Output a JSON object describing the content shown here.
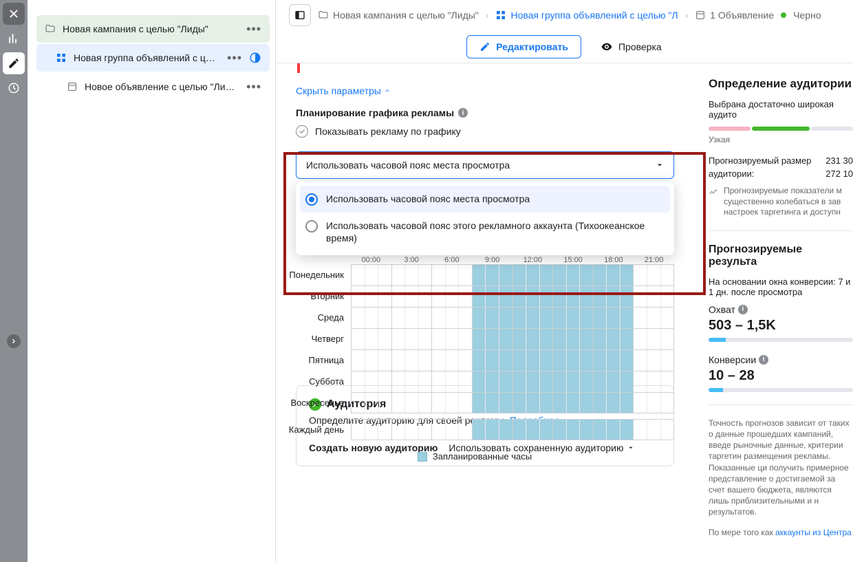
{
  "rail": {
    "close": "×"
  },
  "tree": {
    "campaign": "Новая кампания с целью \"Лиды\"",
    "adset": "Новая группа объявлений с це…",
    "ad": "Новое объявление с целью \"Лиды\""
  },
  "breadcrumb": {
    "campaign": "Новая кампания с целью \"Лиды\"",
    "adset": "Новая группа объявлений с целью \"Л",
    "ad": "1 Объявление",
    "status": "Черно"
  },
  "toolbar": {
    "edit": "Редактировать",
    "review": "Проверка"
  },
  "params": {
    "hide": "Скрыть параметры",
    "scheduleTitle": "Планирование графика рекламы",
    "showBySchedule": "Показывать рекламу по графику"
  },
  "tz": {
    "selected": "Использовать часовой пояс места просмотра",
    "opt1": "Использовать часовой пояс места просмотра",
    "opt2": "Использовать часовой пояс этого рекламного аккаунта (Тихоокеанское время)"
  },
  "schedule": {
    "times": [
      "00:00",
      "3:00",
      "6:00",
      "9:00",
      "12:00",
      "15:00",
      "18:00",
      "21:00"
    ],
    "days": [
      "Понедельник",
      "Вторник",
      "Среда",
      "Четверг",
      "Пятница",
      "Суббота",
      "Воскресенье"
    ],
    "every": "Каждый день",
    "legend": "Запланированные часы"
  },
  "audience": {
    "title": "Аудитория",
    "desc": "Определите аудиторию для своей рекламы. ",
    "more": "Подробнее",
    "create": "Создать новую аудиторию",
    "use": "Использовать сохраненную аудиторию"
  },
  "side": {
    "h1": "Определение аудитории",
    "sub1": "Выбрана достаточно широкая аудито",
    "narrow": "Узкая",
    "estLabel1": "Прогнозируемый размер",
    "estLabel2": "аудитории:",
    "estVal1": "231 30",
    "estVal2": "272 10",
    "flux": "Прогнозируемые показатели м существенно колебаться в зав настроек таргетинга и доступн",
    "h2": "Прогнозируемые результа",
    "sub2": "На основании окна конверсии: 7 и 1 дн. после просмотра",
    "reach": "Охват",
    "reachVal": "503 – 1,5K",
    "conv": "Конверсии",
    "convVal": "10 – 28",
    "disc1": "Точность прогнозов зависит от таких о данные прошедших кампаний, введе рыночные данные, критерии таргетин размещения рекламы. Показанные ци получить примерное представление о достигаемой за счет вашего бюджета, являются лишь приблизительными и н результатов.",
    "disc2a": "По мере того как ",
    "disc2link": "аккаунты из Центра"
  }
}
